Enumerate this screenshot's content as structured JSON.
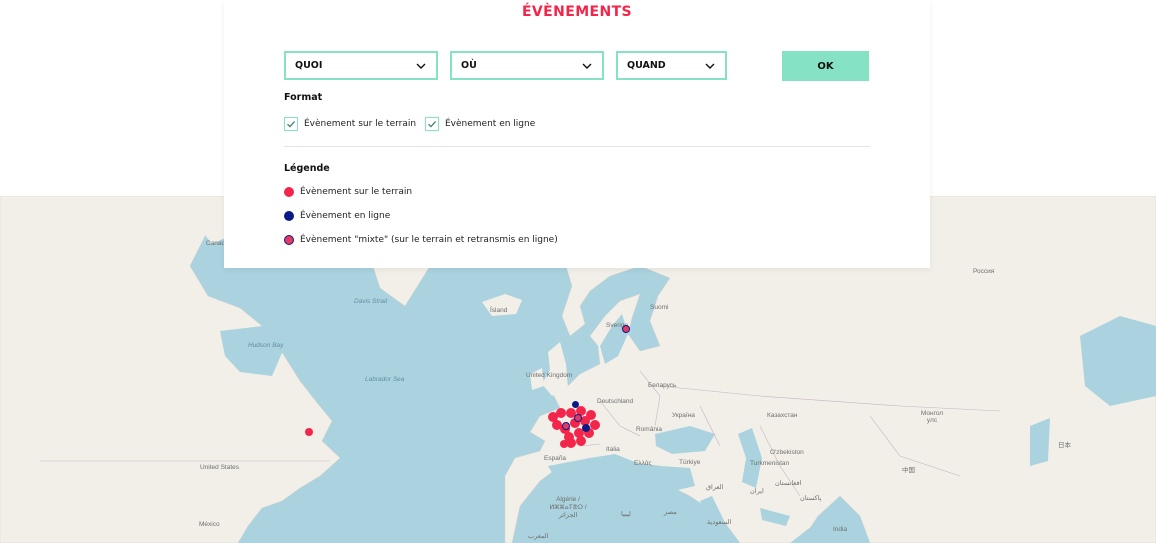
{
  "page": {
    "title": "ÉVÈNEMENTS"
  },
  "filters": {
    "quoi": "QUOI",
    "ou": "OÙ",
    "quand": "QUAND",
    "ok_label": "OK"
  },
  "format": {
    "title": "Format",
    "options": [
      {
        "label": "Évènement sur le terrain",
        "checked": true
      },
      {
        "label": "Évènement en ligne",
        "checked": true
      }
    ]
  },
  "legend": {
    "title": "Légende",
    "items": [
      {
        "label": "Évènement sur le terrain",
        "color": "#f3254a"
      },
      {
        "label": "Évènement en ligne",
        "color": "#0b1a86"
      },
      {
        "label": "Évènement \"mixte\" (sur le terrain et retransmis en ligne)",
        "color": "#e23a63"
      }
    ]
  },
  "map": {
    "colors": {
      "water": "#aad3df",
      "land": "#f2efe9",
      "border": "#b9a8b9"
    },
    "labels": {
      "russia": "Россия",
      "island": "Ísland",
      "sverige": "Sverige",
      "suomi": "Suomi",
      "uk": "United Kingdom",
      "deutschland": "Deutschland",
      "belarus": "Беларусь",
      "ukraine": "Україна",
      "kazakhstan": "Казахстан",
      "mongolia": "Монгол улс",
      "romania": "România",
      "italia": "Italia",
      "espana": "España",
      "ellas": "Ελλάς",
      "turkiye": "Türkiye",
      "uzbekistan": "O'zbekiston",
      "turkmenistan": "Turkmenistan",
      "usa": "United States",
      "mexico": "México",
      "algerie": "Algérie / ⵍⵣⵣⴰⵢⴻⵔ / الجزائر",
      "china": "中国",
      "japan": "日本",
      "india": "India",
      "iran": "ایران",
      "iraq": "العراق",
      "libya": "ليبيا",
      "egypt": "مصر",
      "saudi": "السعودية",
      "afghanistan": "افغانستان",
      "pakistan": "پاکستان",
      "morocco": "المغرب",
      "canada": "Canada",
      "hudson": "Hudson Bay",
      "labrador": "Labrador Sea",
      "denmark_strait": "Davis Strait"
    }
  }
}
